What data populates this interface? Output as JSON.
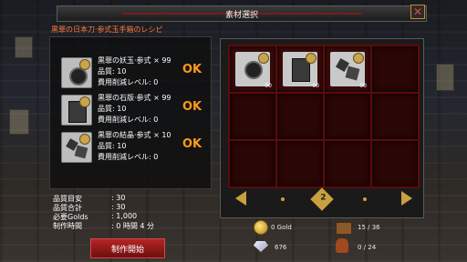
{
  "header": {
    "title": "素材選択",
    "close_icon": "close-icon"
  },
  "recipe": {
    "title": "黒罪の日本刀·参式玉手箱のレシピ"
  },
  "materials": [
    {
      "name": "黒罪の妖玉·参式 × 99",
      "quality": "品質: 10",
      "level": "費用削減レベル: 0",
      "status": "OK",
      "icon": "orb-icon"
    },
    {
      "name": "黒罪の石版·参式 × 99",
      "quality": "品質: 10",
      "level": "費用削減レベル: 0",
      "status": "OK",
      "icon": "stone-tablet-icon"
    },
    {
      "name": "黒罪の結晶·参式 × 10",
      "quality": "品質: 10",
      "level": "費用削減レベル: 0",
      "status": "OK",
      "icon": "crystal-icon"
    }
  ],
  "stats": [
    {
      "label": "品質目安",
      "value": ": 30"
    },
    {
      "label": "品質合計",
      "value": ": 30"
    },
    {
      "label": "必要Golds",
      "value": ": 1,000"
    },
    {
      "label": "制作時間",
      "value": ": 0 時間 4 分"
    }
  ],
  "start_button": "制作開始",
  "inventory": {
    "slots": [
      {
        "filled": true,
        "icon": "orb-icon",
        "count": "00"
      },
      {
        "filled": true,
        "icon": "stone-tablet-icon",
        "count": "00"
      },
      {
        "filled": true,
        "icon": "crystal-icon",
        "count": "00"
      },
      {
        "filled": false
      },
      {
        "filled": false
      },
      {
        "filled": false
      },
      {
        "filled": false
      },
      {
        "filled": false
      },
      {
        "filled": false
      },
      {
        "filled": false
      },
      {
        "filled": false
      },
      {
        "filled": false
      }
    ],
    "page": "2"
  },
  "resources": {
    "gold": "0 Gold",
    "storage": "15 / 36",
    "gems": "676",
    "bag": "0 / 24"
  },
  "colors": {
    "ok": "#ff9a1a",
    "accent": "#c8a040",
    "slot_border": "#5e0a0a",
    "button": "#b52424"
  }
}
